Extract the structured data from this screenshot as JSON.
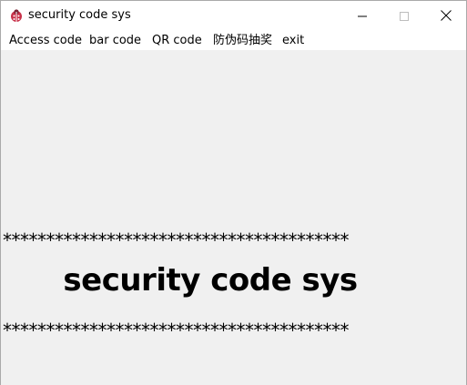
{
  "window": {
    "title": "security code sys",
    "icon": "ladybug-icon"
  },
  "menu": {
    "items": [
      {
        "label": "Access code"
      },
      {
        "label": "bar code"
      },
      {
        "label": "QR code"
      },
      {
        "label": "防伪码抽奖"
      },
      {
        "label": "exit"
      }
    ]
  },
  "main": {
    "stars_top": "****************************************",
    "heading": "security code sys",
    "stars_bottom": "****************************************"
  },
  "colors": {
    "titlebar_bg": "#ffffff",
    "client_bg": "#f0f0f0",
    "text": "#000000"
  }
}
